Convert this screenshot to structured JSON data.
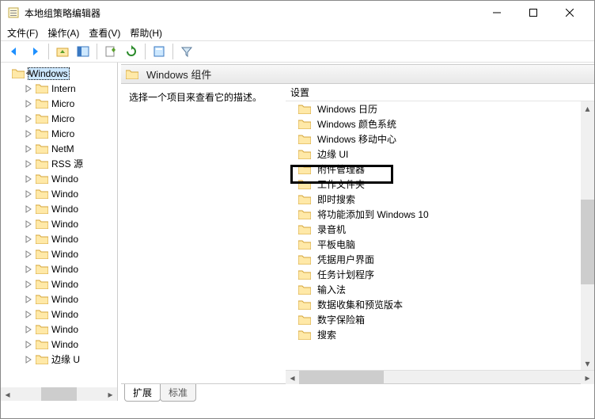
{
  "window": {
    "title": "本地组策略编辑器"
  },
  "menu": {
    "file": "文件(F)",
    "action": "操作(A)",
    "view": "查看(V)",
    "help": "帮助(H)"
  },
  "tree": {
    "root": "Windows",
    "items": [
      "Intern",
      "Micro",
      "Micro",
      "Micro",
      "NetM",
      "RSS 源",
      "Windo",
      "Windo",
      "Windo",
      "Windo",
      "Windo",
      "Windo",
      "Windo",
      "Windo",
      "Windo",
      "Windo",
      "Windo",
      "Windo",
      "边缘 U"
    ]
  },
  "header": {
    "title": "Windows 组件"
  },
  "desc": {
    "text": "选择一个项目来查看它的描述。"
  },
  "list": {
    "column": "设置",
    "items": [
      "Windows 日历",
      "Windows 颜色系统",
      "Windows 移动中心",
      "边缘 UI",
      "附件管理器",
      "工作文件夹",
      "即时搜索",
      "将功能添加到 Windows 10",
      "录音机",
      "平板电脑",
      "凭据用户界面",
      "任务计划程序",
      "输入法",
      "数据收集和预览版本",
      "数字保险箱",
      "搜索"
    ]
  },
  "tabs": {
    "extended": "扩展",
    "standard": "标准"
  }
}
